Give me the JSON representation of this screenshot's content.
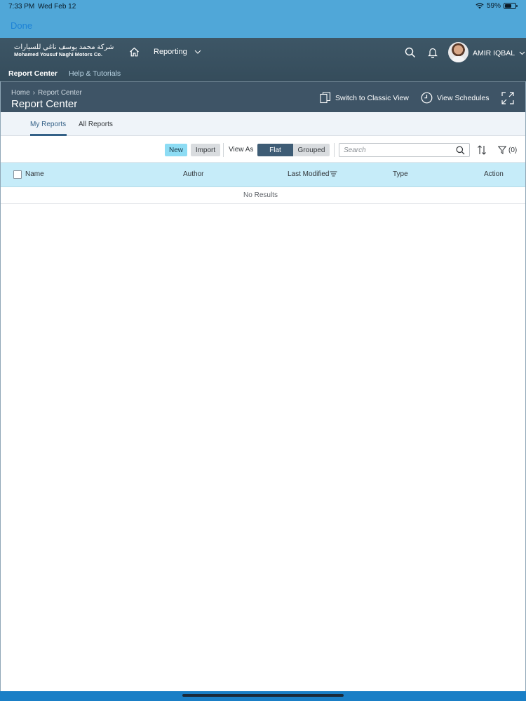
{
  "status_bar": {
    "time": "7:33 PM",
    "date": "Wed Feb 12",
    "battery": "59%"
  },
  "top_bar": {
    "done_label": "Done"
  },
  "shell": {
    "logo_arabic": "شركة محمد يوسف ناغي للسيارات",
    "logo_english": "Mohamed Yousuf Naghi Motors Co.",
    "menu_label": "Reporting",
    "user_name": "AMIR IQBAL",
    "nav": [
      "Report Center",
      "Help & Tutorials"
    ]
  },
  "page_header": {
    "breadcrumb": [
      "Home",
      "Report Center"
    ],
    "title": "Report Center",
    "actions": {
      "classic_view": "Switch to Classic View",
      "schedules": "View Schedules"
    }
  },
  "tabs": [
    "My Reports",
    "All Reports"
  ],
  "toolbar": {
    "new_label": "New",
    "import_label": "Import",
    "view_as_label": "View As",
    "view_options": [
      "Flat",
      "Grouped"
    ],
    "selected_view": "Flat",
    "search_placeholder": "Search",
    "filter_label": "(0)"
  },
  "table": {
    "columns": [
      "Name",
      "Author",
      "Last Modified",
      "Type",
      "Action"
    ],
    "empty_text": "No Results"
  },
  "colors": {
    "shell_bg": "#3d5666",
    "accent_new": "#8ddcf4",
    "table_header": "#c6ecf9",
    "segment_selected": "#3e5c75"
  }
}
